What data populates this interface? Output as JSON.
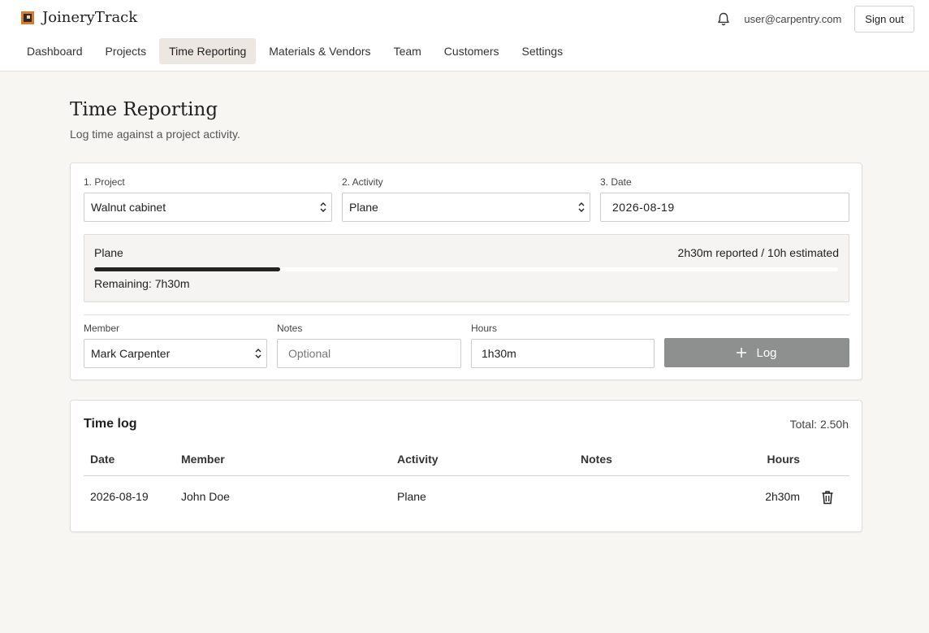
{
  "app": {
    "name": "JoineryTrack"
  },
  "header": {
    "user_email": "user@carpentry.com",
    "sign_out_label": "Sign out"
  },
  "nav": {
    "items": [
      {
        "label": "Dashboard",
        "active": false
      },
      {
        "label": "Projects",
        "active": false
      },
      {
        "label": "Time Reporting",
        "active": true
      },
      {
        "label": "Materials & Vendors",
        "active": false
      },
      {
        "label": "Team",
        "active": false
      },
      {
        "label": "Customers",
        "active": false
      },
      {
        "label": "Settings",
        "active": false
      }
    ]
  },
  "page": {
    "title": "Time Reporting",
    "subtitle": "Log time against a project activity."
  },
  "entry": {
    "project": {
      "label": "1. Project",
      "value": "Walnut cabinet"
    },
    "activity": {
      "label": "2. Activity",
      "value": "Plane"
    },
    "date": {
      "label": "3. Date",
      "value": "2026-08-19"
    },
    "progress": {
      "activity": "Plane",
      "summary": "2h30m reported / 10h estimated",
      "remaining": "Remaining: 7h30m",
      "fraction": 0.25
    },
    "member": {
      "label": "Member",
      "value": "Mark Carpenter"
    },
    "notes": {
      "label": "Notes",
      "placeholder": "Optional"
    },
    "hours": {
      "label": "Hours",
      "value": "1h30m"
    },
    "log_button": "Log"
  },
  "time_log": {
    "title": "Time log",
    "total": "Total: 2.50h",
    "columns": {
      "date": "Date",
      "member": "Member",
      "activity": "Activity",
      "notes": "Notes",
      "hours": "Hours"
    },
    "rows": [
      {
        "date": "2026-08-19",
        "member": "John Doe",
        "activity": "Plane",
        "notes": "",
        "hours": "2h30m"
      }
    ]
  },
  "colors": {
    "accent_logo": "#d97b2b",
    "active_tab_bg": "#ece7e1",
    "log_button_bg": "#8e908f",
    "progress_fill": "#222222"
  },
  "icons": {
    "logo": "joinery-logo-icon",
    "notifications": "bell-icon",
    "log_button": "plus-icon",
    "row_delete": "trash-icon",
    "select": "chevron-updown-icon"
  }
}
